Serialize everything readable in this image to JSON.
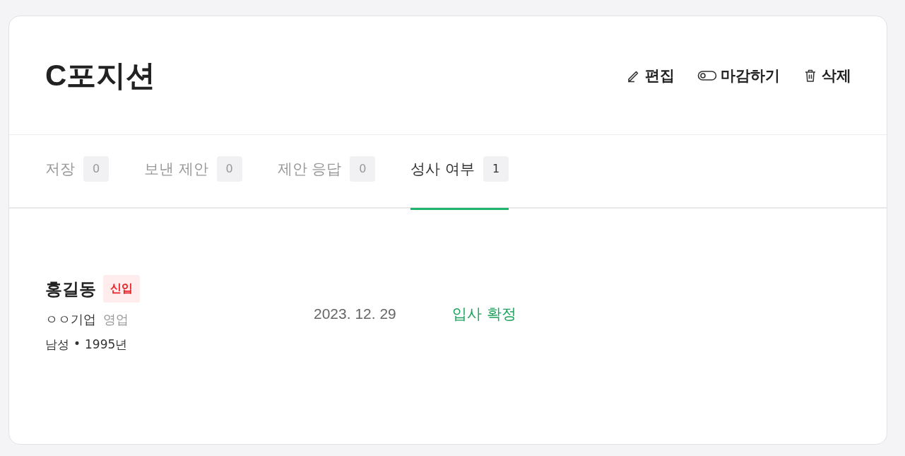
{
  "title": "C포지션",
  "actions": [
    {
      "kind": "edit",
      "label": "편집"
    },
    {
      "kind": "close",
      "label": "마감하기"
    },
    {
      "kind": "delete",
      "label": "삭제"
    }
  ],
  "tabs": [
    {
      "label": "저장",
      "count": "0",
      "selected": false
    },
    {
      "label": "보낸 제안",
      "count": "0",
      "selected": false
    },
    {
      "label": "제안 응답",
      "count": "0",
      "selected": false
    },
    {
      "label": "성사 여부",
      "count": "1",
      "selected": true
    }
  ],
  "candidates": [
    {
      "name": "홍길동",
      "tag": "신입",
      "company": "ㅇㅇ기업",
      "role": "영업",
      "gender": "남성",
      "separator": "•",
      "birth_year": "1995년",
      "date": "2023. 12. 29",
      "status": "입사 확정"
    }
  ]
}
